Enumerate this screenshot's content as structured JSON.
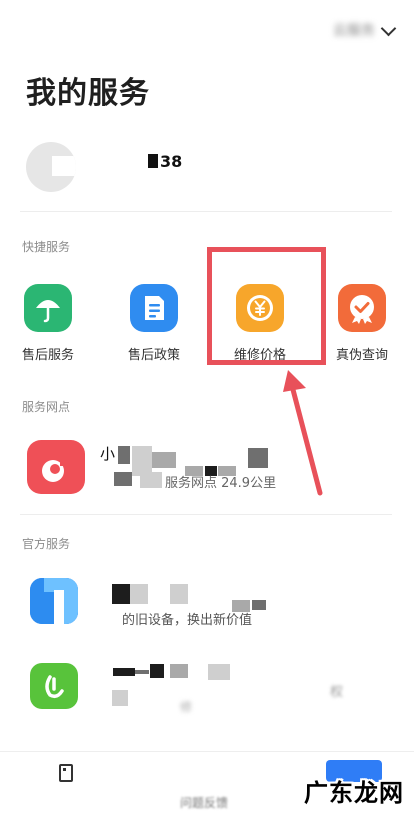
{
  "header": {
    "account_name": "云服务",
    "page_title": "我的服务"
  },
  "profile": {
    "id_suffix": "​38"
  },
  "sections": {
    "quick": "快捷服务",
    "stores": "服务网点",
    "official": "官方服务"
  },
  "quick_services": [
    {
      "label": "售后服务",
      "icon": "umbrella-icon",
      "color": "#2bb673"
    },
    {
      "label": "售后政策",
      "icon": "document-icon",
      "color": "#2f8cf0"
    },
    {
      "label": "维修价格",
      "icon": "yen-coin-icon",
      "color": "#f7a62b"
    },
    {
      "label": "真伪查询",
      "icon": "verify-badge-icon",
      "color": "#f26b3a"
    }
  ],
  "store": {
    "name_prefix": "小",
    "info": "服务网点 24.9公里"
  },
  "official": [
    {
      "desc": "的旧设备，换出新价值",
      "icon": "blue-app-icon",
      "color": "#2d8cf0"
    },
    {
      "desc": "权",
      "sub": "修",
      "icon": "green-app-icon",
      "color": "#58c33b"
    }
  ],
  "tabbar": {
    "center_label": "问题反馈"
  },
  "watermark": "广东龙网",
  "colors": {
    "highlight": "#e8515a",
    "arrow": "#e8515a"
  }
}
